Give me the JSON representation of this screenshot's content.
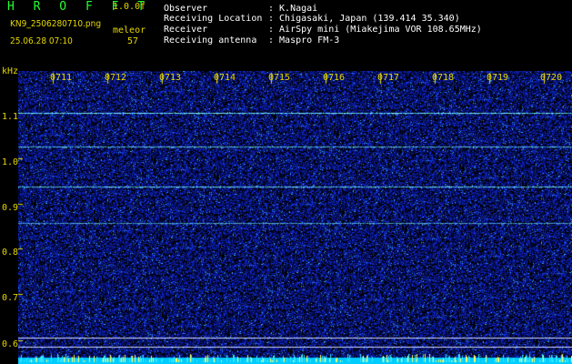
{
  "header": {
    "app_title": "H R O F F T",
    "version": "1.0.0f",
    "filename": "KN9_2506280710.png",
    "software": "meleor",
    "datetime": "25.06.28 07:10",
    "count": "57"
  },
  "info": [
    {
      "key": "Observer",
      "value": ": K.Nagai"
    },
    {
      "key": "Receiving Location",
      "value": ": Chigasaki, Japan (139.414 35.340)"
    },
    {
      "key": "Receiver",
      "value": ": AirSpy mini (Miakejima VOR 108.65MHz)"
    },
    {
      "key": "Receiving antenna",
      "value": ": Maspro FM-3"
    }
  ],
  "axis": {
    "unit": "kHz",
    "y_ticks": [
      "1.1",
      "1.0",
      "0.9",
      "0.8",
      "0.7",
      "0.6"
    ],
    "x_ticks": [
      "0711",
      "0712",
      "0713",
      "0714",
      "0715",
      "0716",
      "0717",
      "0718",
      "0719",
      "0720"
    ]
  },
  "colors": {
    "background": "#000000",
    "noise": "#1a2ec8",
    "label": "#e6d800",
    "title": "#22ff33",
    "signal": "#7ff5ff"
  }
}
